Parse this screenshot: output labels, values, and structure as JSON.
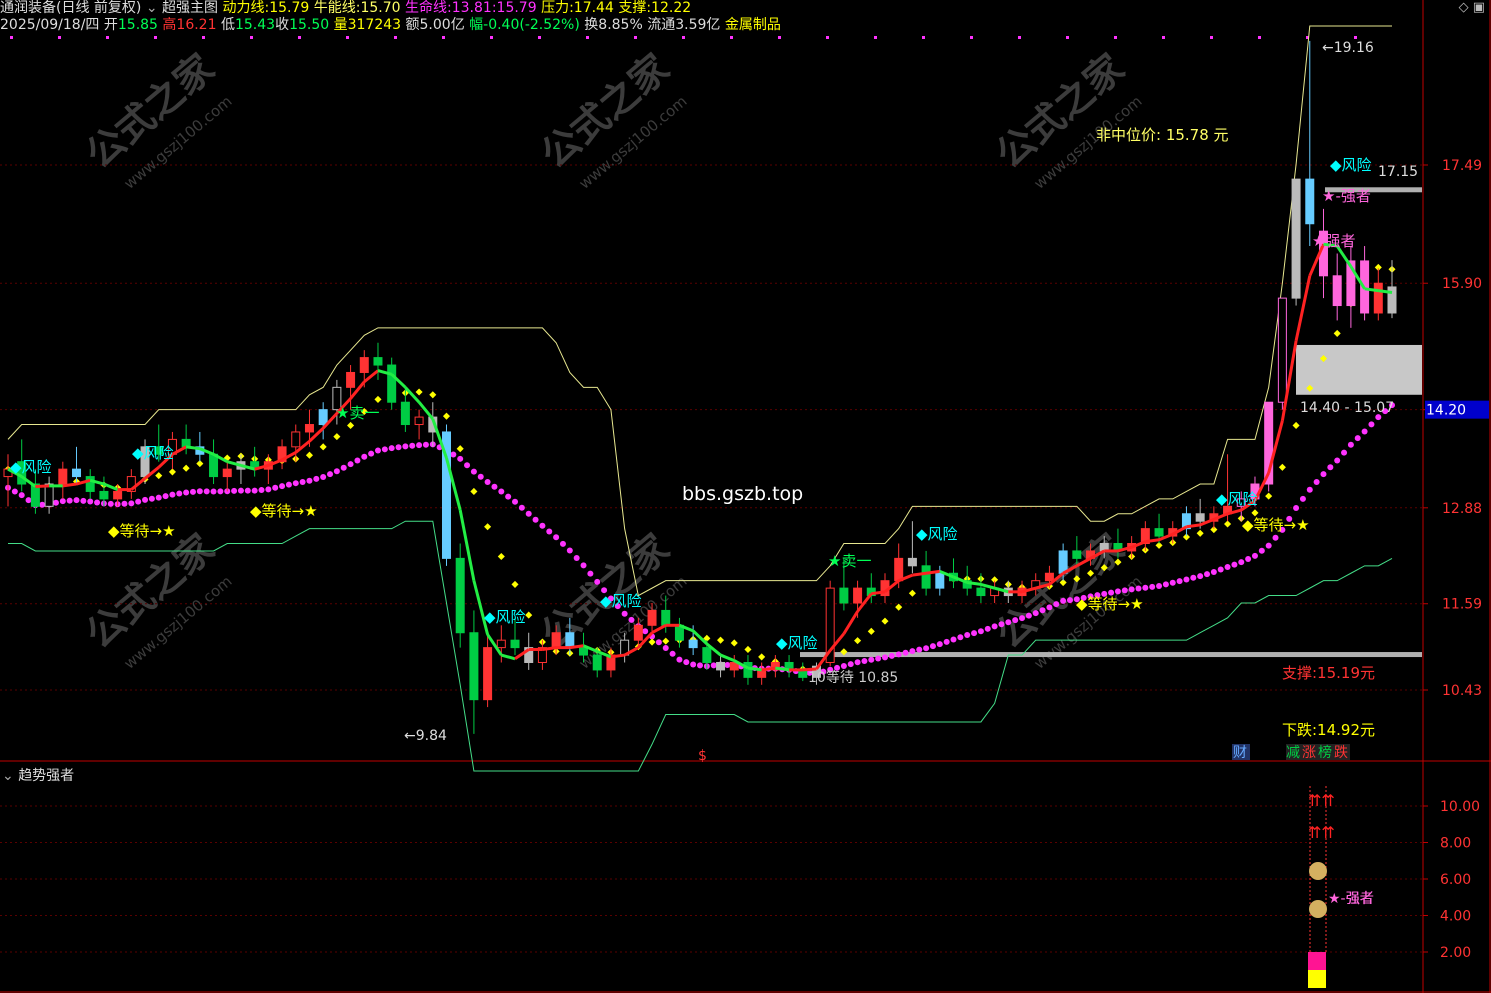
{
  "header": {
    "name": "通润装备(日线 前复权)",
    "indicator_name": "超强主图",
    "dongli_label": "动力线:",
    "dongli_val": "15.79",
    "niuneng_label": "牛能线:",
    "niuneng_val": "15.70",
    "shengming_label": "生命线:",
    "shengming_val": "13.81",
    "shengming_sep": ":",
    "shengming_val2": "15.79",
    "yali_label": "压力:",
    "yali_val": "17.44",
    "zhicheng_label": "支撑:",
    "zhicheng_val": "12.22",
    "date": "2025/09/18/四",
    "open_label": "开",
    "open_val": "15.85",
    "high_label": "高",
    "high_val": "16.21",
    "low_label": "低",
    "low_val": "15.43",
    "close_label": "收",
    "close_val": "15.50",
    "vol_label": "量",
    "vol_val": "317243",
    "amt_label": "额",
    "amt_val": "5.00亿",
    "chg_label": "幅",
    "chg_val": "-0.40(-2.52%)",
    "turn_label": "换",
    "turn_val": "8.85%",
    "float_label": "流通",
    "float_val": "3.59亿",
    "sector": "金属制品"
  },
  "sub_panel_title": "趋势强者",
  "watermark": {
    "cn": "公式之家",
    "url": "www.gszj100.com"
  },
  "site_text": "bbs.gszb.top",
  "annotations": {
    "risk": "风险",
    "sell1": "卖一",
    "wait_arrow": "等待→",
    "wait_arrow_star": "等待→★",
    "wait": "等待",
    "strong": "强者",
    "strong_star": "★-强者",
    "high_mark": "19.16",
    "low_mark": "9.84",
    "low_arrow": "←9.84",
    "mid_price": "非中位价: 15.78 元",
    "zone_range": "14.40 - 15.07",
    "support": "支撑:15.19元",
    "drop": "下跌:14.92元",
    "price_1715": "17.15",
    "wait_1085": "10等待 10.85",
    "cai": "财",
    "jian": "减",
    "zhang": "涨",
    "bang": "榜",
    "die": "跌",
    "dollar": "$",
    "current_tag": "14.20"
  },
  "icons": {
    "title_toggle": "chevron-down-icon",
    "top_right_1": "diamond-icon",
    "top_right_2": "window-icon"
  },
  "colors": {
    "bg": "#000000",
    "up": "#ff3333",
    "down": "#00cc44",
    "pink": "#ff66dd",
    "yellow": "#ffff00",
    "magenta": "#ff33ff",
    "cyan": "#00ffff",
    "axis": "#c00000"
  },
  "chart_data": [
    {
      "type": "candlestick",
      "panel": "main",
      "yaxis_ticks": [
        17.49,
        15.9,
        14.2,
        12.88,
        11.59,
        10.43
      ],
      "ylim": [
        9.3,
        19.4
      ],
      "candles": [
        [
          13.3,
          13.6,
          12.9,
          13.4
        ],
        [
          13.5,
          13.8,
          13.1,
          13.2
        ],
        [
          13.2,
          13.4,
          12.8,
          12.9
        ],
        [
          12.9,
          13.3,
          12.8,
          13.2
        ],
        [
          13.2,
          13.5,
          13.0,
          13.4
        ],
        [
          13.4,
          13.7,
          13.2,
          13.3
        ],
        [
          13.3,
          13.4,
          13.0,
          13.1
        ],
        [
          13.1,
          13.3,
          12.9,
          13.0
        ],
        [
          13.0,
          13.2,
          12.9,
          13.1
        ],
        [
          13.1,
          13.4,
          13.0,
          13.3
        ],
        [
          13.3,
          13.8,
          13.2,
          13.7
        ],
        [
          13.7,
          14.0,
          13.5,
          13.6
        ],
        [
          13.6,
          13.9,
          13.4,
          13.8
        ],
        [
          13.8,
          14.0,
          13.6,
          13.7
        ],
        [
          13.7,
          13.9,
          13.5,
          13.6
        ],
        [
          13.6,
          13.8,
          13.2,
          13.3
        ],
        [
          13.3,
          13.5,
          13.1,
          13.4
        ],
        [
          13.4,
          13.6,
          13.2,
          13.5
        ],
        [
          13.5,
          13.7,
          13.3,
          13.4
        ],
        [
          13.4,
          13.6,
          13.2,
          13.5
        ],
        [
          13.5,
          13.8,
          13.4,
          13.7
        ],
        [
          13.7,
          14.0,
          13.5,
          13.9
        ],
        [
          13.9,
          14.2,
          13.7,
          14.0
        ],
        [
          14.0,
          14.3,
          13.8,
          14.2
        ],
        [
          14.2,
          14.6,
          14.0,
          14.5
        ],
        [
          14.5,
          14.8,
          14.2,
          14.7
        ],
        [
          14.7,
          15.0,
          14.5,
          14.9
        ],
        [
          14.9,
          15.1,
          14.6,
          14.8
        ],
        [
          14.8,
          14.9,
          14.2,
          14.3
        ],
        [
          14.3,
          14.5,
          13.9,
          14.0
        ],
        [
          14.0,
          14.2,
          13.8,
          14.1
        ],
        [
          14.1,
          14.3,
          13.7,
          13.9
        ],
        [
          13.9,
          14.0,
          12.1,
          12.2
        ],
        [
          12.2,
          12.4,
          11.0,
          11.2
        ],
        [
          11.2,
          11.5,
          9.84,
          10.3
        ],
        [
          10.3,
          11.2,
          10.2,
          11.0
        ],
        [
          11.0,
          11.3,
          10.8,
          11.1
        ],
        [
          11.1,
          11.4,
          10.9,
          11.0
        ],
        [
          11.0,
          11.2,
          10.7,
          10.8
        ],
        [
          10.8,
          11.1,
          10.7,
          11.0
        ],
        [
          11.0,
          11.3,
          10.9,
          11.2
        ],
        [
          11.2,
          11.4,
          10.9,
          11.0
        ],
        [
          11.0,
          11.2,
          10.8,
          10.9
        ],
        [
          10.9,
          11.0,
          10.6,
          10.7
        ],
        [
          10.7,
          11.0,
          10.6,
          10.9
        ],
        [
          10.9,
          11.2,
          10.8,
          11.1
        ],
        [
          11.1,
          11.4,
          11.0,
          11.3
        ],
        [
          11.3,
          11.6,
          11.2,
          11.5
        ],
        [
          11.5,
          11.7,
          11.2,
          11.3
        ],
        [
          11.3,
          11.4,
          11.0,
          11.1
        ],
        [
          11.1,
          11.3,
          10.9,
          11.0
        ],
        [
          11.0,
          11.1,
          10.7,
          10.8
        ],
        [
          10.8,
          10.9,
          10.6,
          10.7
        ],
        [
          10.7,
          10.9,
          10.6,
          10.8
        ],
        [
          10.8,
          10.9,
          10.5,
          10.6
        ],
        [
          10.6,
          10.8,
          10.5,
          10.7
        ],
        [
          10.7,
          10.9,
          10.6,
          10.8
        ],
        [
          10.8,
          10.9,
          10.6,
          10.7
        ],
        [
          10.7,
          10.8,
          10.55,
          10.6
        ],
        [
          10.6,
          10.8,
          10.5,
          10.75
        ],
        [
          10.8,
          11.9,
          10.75,
          11.8
        ],
        [
          11.8,
          12.2,
          11.5,
          11.6
        ],
        [
          11.6,
          11.9,
          11.4,
          11.8
        ],
        [
          11.8,
          12.0,
          11.6,
          11.7
        ],
        [
          11.7,
          12.0,
          11.6,
          11.9
        ],
        [
          11.9,
          12.4,
          11.8,
          12.2
        ],
        [
          12.2,
          12.7,
          12.0,
          12.1
        ],
        [
          12.1,
          12.3,
          11.7,
          11.8
        ],
        [
          11.8,
          12.1,
          11.7,
          12.0
        ],
        [
          12.0,
          12.2,
          11.8,
          11.9
        ],
        [
          11.9,
          12.1,
          11.7,
          11.8
        ],
        [
          11.8,
          12.0,
          11.6,
          11.7
        ],
        [
          11.7,
          11.9,
          11.6,
          11.8
        ],
        [
          11.8,
          11.9,
          11.6,
          11.7
        ],
        [
          11.7,
          11.9,
          11.6,
          11.8
        ],
        [
          11.8,
          12.0,
          11.7,
          11.9
        ],
        [
          11.9,
          12.1,
          11.8,
          12.0
        ],
        [
          12.0,
          12.4,
          11.9,
          12.3
        ],
        [
          12.3,
          12.5,
          12.1,
          12.2
        ],
        [
          12.2,
          12.4,
          12.1,
          12.3
        ],
        [
          12.3,
          12.5,
          12.2,
          12.4
        ],
        [
          12.4,
          12.6,
          12.2,
          12.3
        ],
        [
          12.3,
          12.5,
          12.2,
          12.4
        ],
        [
          12.4,
          12.7,
          12.3,
          12.6
        ],
        [
          12.6,
          12.8,
          12.4,
          12.5
        ],
        [
          12.5,
          12.7,
          12.4,
          12.6
        ],
        [
          12.6,
          12.9,
          12.5,
          12.8
        ],
        [
          12.8,
          13.0,
          12.6,
          12.7
        ],
        [
          12.7,
          12.9,
          12.6,
          12.8
        ],
        [
          12.8,
          13.6,
          12.7,
          12.9
        ],
        [
          12.9,
          13.1,
          12.7,
          13.0
        ],
        [
          13.0,
          13.3,
          12.9,
          13.2
        ],
        [
          13.2,
          14.3,
          13.1,
          14.3
        ],
        [
          14.3,
          15.7,
          14.2,
          15.7
        ],
        [
          15.7,
          17.3,
          15.6,
          17.3
        ],
        [
          17.3,
          19.16,
          16.4,
          16.7
        ],
        [
          16.6,
          16.9,
          15.7,
          16.0
        ],
        [
          16.0,
          16.3,
          15.4,
          15.6
        ],
        [
          15.6,
          16.4,
          15.3,
          16.2
        ],
        [
          16.2,
          16.4,
          15.4,
          15.5
        ],
        [
          15.5,
          16.1,
          15.4,
          15.9
        ],
        [
          15.85,
          16.21,
          15.43,
          15.5
        ]
      ]
    },
    {
      "type": "indicator",
      "panel": "sub",
      "title": "趋势强者",
      "yaxis_ticks": [
        10.0,
        8.0,
        6.0,
        4.0,
        2.0
      ]
    }
  ]
}
